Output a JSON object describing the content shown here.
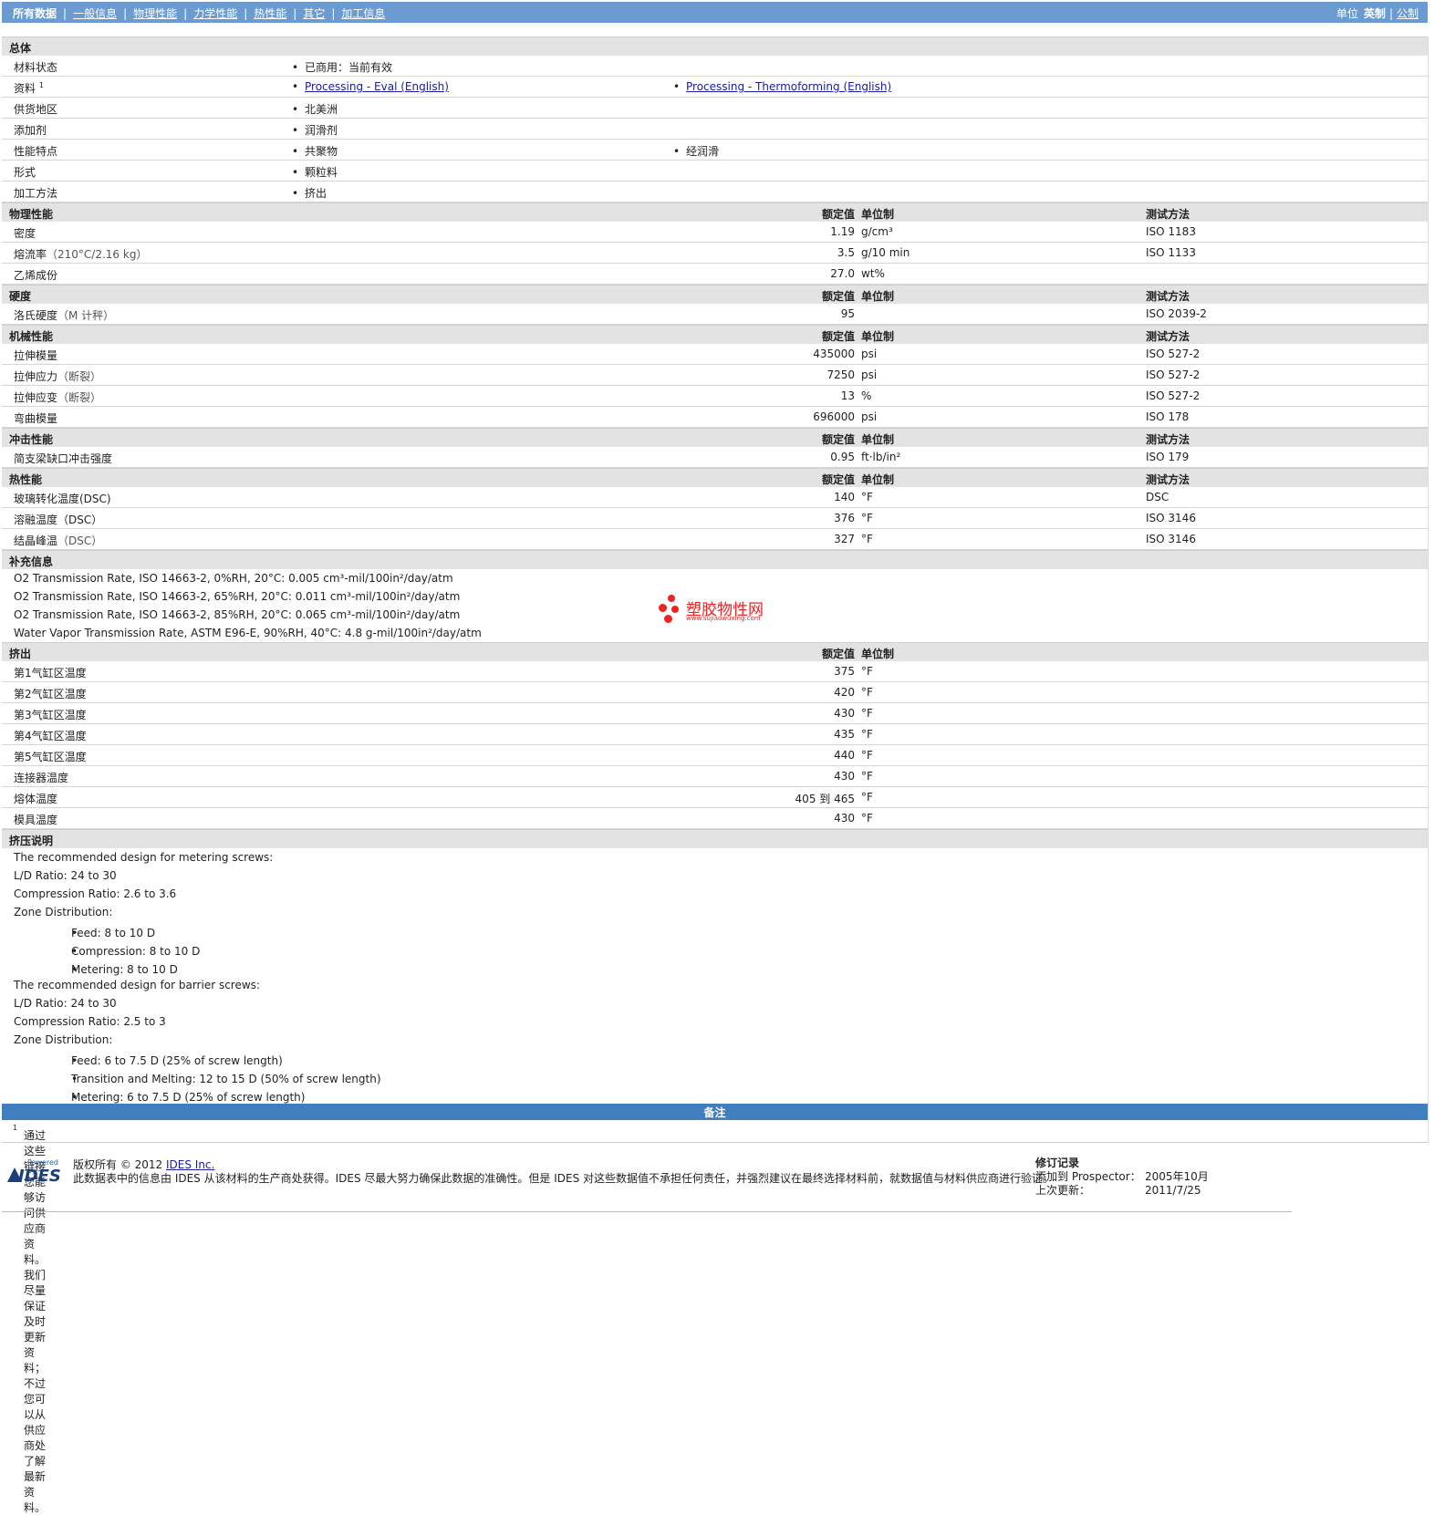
{
  "nav": {
    "tabs": [
      "所有数据",
      "一般信息",
      "物理性能",
      "力学性能",
      "热性能",
      "其它",
      "加工信息"
    ],
    "units_label": "单位",
    "units_english": "英制",
    "units_metric": "公制"
  },
  "headers": {
    "nominal": "额定值",
    "unit": "单位制",
    "method": "测试方法"
  },
  "general": {
    "title": "总体",
    "status_label": "材料状态",
    "status_value": "已商用：当前有效",
    "resources_label": "资料",
    "resources_sup": "1",
    "resource_1": "Processing - Eval (English)",
    "resource_2": "Processing - Thermoforming (English)",
    "region_label": "供货地区",
    "region_value": "北美洲",
    "additive_label": "添加剂",
    "additive_value": "润滑剂",
    "features_label": "性能特点",
    "feature_1": "共聚物",
    "feature_2": "经润滑",
    "form_label": "形式",
    "form_value": "颗粒料",
    "process_label": "加工方法",
    "process_value": "挤出"
  },
  "physical": {
    "title": "物理性能",
    "rows": [
      {
        "label": "密度",
        "cond": "",
        "value": "1.19",
        "unit": "g/cm³",
        "method": "ISO 1183"
      },
      {
        "label": "熔流率",
        "cond": "（210°C/2.16 kg）",
        "value": "3.5",
        "unit": "g/10 min",
        "method": "ISO 1133"
      },
      {
        "label": "乙烯成份",
        "cond": "",
        "value": "27.0",
        "unit": "wt%",
        "method": ""
      }
    ]
  },
  "hardness": {
    "title": "硬度",
    "rows": [
      {
        "label": "洛氏硬度",
        "cond": "（M 计秤）",
        "value": "95",
        "unit": "",
        "method": "ISO 2039-2"
      }
    ]
  },
  "mechanical": {
    "title": "机械性能",
    "rows": [
      {
        "label": "拉伸模量",
        "cond": "",
        "value": "435000",
        "unit": "psi",
        "method": "ISO 527-2"
      },
      {
        "label": "拉伸应力",
        "cond": "（断裂）",
        "value": "7250",
        "unit": "psi",
        "method": "ISO 527-2"
      },
      {
        "label": "拉伸应变",
        "cond": "（断裂）",
        "value": "13",
        "unit": "%",
        "method": "ISO 527-2"
      },
      {
        "label": "弯曲模量",
        "cond": "",
        "value": "696000",
        "unit": "psi",
        "method": "ISO 178"
      }
    ]
  },
  "impact": {
    "title": "冲击性能",
    "rows": [
      {
        "label": "简支梁缺口冲击强度",
        "cond": "",
        "value": "0.95",
        "unit": "ft·lb/in²",
        "method": "ISO 179"
      }
    ]
  },
  "thermal": {
    "title": "热性能",
    "rows": [
      {
        "label": "玻璃转化温度(DSC)",
        "cond": "",
        "value": "140",
        "unit": "°F",
        "method": "DSC"
      },
      {
        "label": "溶融温度（DSC）",
        "cond": "",
        "value": "376",
        "unit": "°F",
        "method": "ISO 3146"
      },
      {
        "label": "结晶峰温",
        "cond": "（DSC）",
        "value": "327",
        "unit": "°F",
        "method": "ISO 3146"
      }
    ]
  },
  "supplement": {
    "title": "补充信息",
    "lines": [
      "O2 Transmission Rate, ISO 14663-2, 0%RH, 20°C: 0.005 cm³-mil/100in²/day/atm",
      "O2 Transmission Rate, ISO 14663-2, 65%RH, 20°C: 0.011 cm³-mil/100in²/day/atm",
      "O2 Transmission Rate, ISO 14663-2, 85%RH, 20°C: 0.065 cm³-mil/100in²/day/atm",
      "Water Vapor Transmission Rate, ASTM E96-E, 90%RH, 40°C: 4.8 g-mil/100in²/day/atm"
    ]
  },
  "watermark": {
    "text": "塑胶物性网",
    "url": "www.sujiaowuxing.com"
  },
  "extrusion": {
    "title": "挤出",
    "rows": [
      {
        "label": "第1气缸区温度",
        "value": "375",
        "unit": "°F"
      },
      {
        "label": "第2气缸区温度",
        "value": "420",
        "unit": "°F"
      },
      {
        "label": "第3气缸区温度",
        "value": "430",
        "unit": "°F"
      },
      {
        "label": "第4气缸区温度",
        "value": "435",
        "unit": "°F"
      },
      {
        "label": "第5气缸区温度",
        "value": "440",
        "unit": "°F"
      },
      {
        "label": "连接器温度",
        "value": "430",
        "unit": "°F"
      },
      {
        "label": "熔体温度",
        "value": "405 到  465",
        "unit": "°F"
      },
      {
        "label": "模具温度",
        "value": "430",
        "unit": "°F"
      }
    ]
  },
  "extrusion_notes": {
    "title": "挤压说明",
    "l1": "The recommended design for metering screws:",
    "l2": "L/D Ratio: 24 to 30",
    "l3": "Compression Ratio: 2.6 to 3.6",
    "l4": "Zone Distribution:",
    "b1": "Feed: 8 to 10 D",
    "b2": "Compression: 8 to 10 D",
    "b3": "Metering: 8 to 10 D",
    "l5": "The recommended design for barrier screws:",
    "l6": "L/D Ratio: 24 to 30",
    "l7": "Compression Ratio: 2.5 to 3",
    "l8": "Zone Distribution:",
    "b4": "Feed: 6 to 7.5 D (25% of screw length)",
    "b5": "Transition and Melting: 12 to 15 D (50% of screw length)",
    "b6": "Metering: 6 to 7.5 D (25% of screw length)"
  },
  "remarks": {
    "title": "备注",
    "sup": "1",
    "text": "通过这些链接您能够访问供应商资料。我们尽量保证及时更新资料；不过您可以从供应商处了解最新资料。"
  },
  "footer": {
    "powered_by": "Powered by",
    "logo": "IDES",
    "copyright_prefix": "版权所有 © 2012 ",
    "copyright_link": "IDES Inc.",
    "disclaimer": "此数据表中的信息由 IDES 从该材料的生产商处获得。IDES 尽最大努力确保此数据的准确性。但是 IDES 对这些数据值不承担任何责任，并强烈建议在最终选择材料前，就数据值与材料供应商进行验证。",
    "rev_title": "修订记录",
    "added_label": "添加到 Prospector：",
    "added_value": "2005年10月",
    "updated_label": "上次更新：",
    "updated_value": "2011/7/25"
  }
}
